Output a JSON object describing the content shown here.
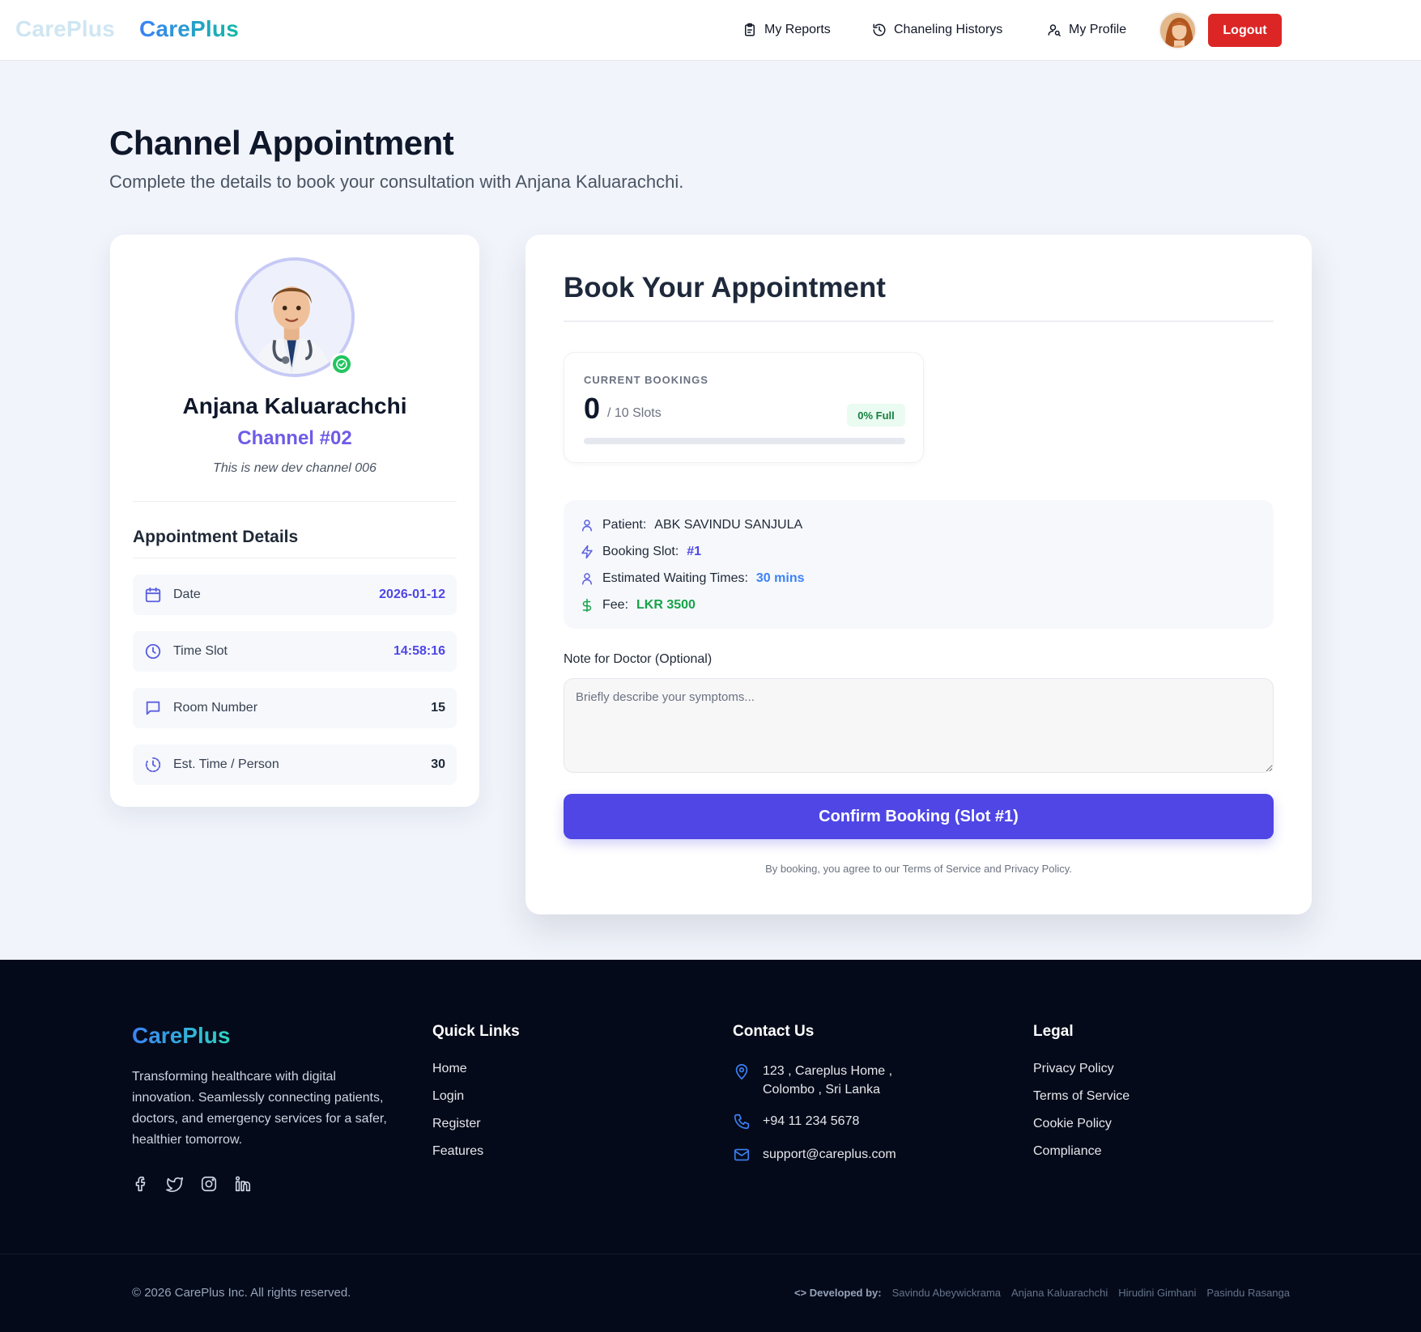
{
  "header": {
    "brand_ghost": "CarePlus",
    "brand": "CarePlus",
    "nav": {
      "reports": "My Reports",
      "history": "Chaneling Historys",
      "profile": "My Profile"
    },
    "logout_label": "Logout"
  },
  "page": {
    "title": "Channel Appointment",
    "subtitle": "Complete the details to book your consultation with Anjana Kaluarachchi."
  },
  "doctor": {
    "name": "Anjana Kaluarachchi",
    "channel": "Channel #02",
    "description": "This is new dev channel 006",
    "details_title": "Appointment Details",
    "details": [
      {
        "label": "Date",
        "value": "2026-01-12",
        "icon": "calendar-icon"
      },
      {
        "label": "Time Slot",
        "value": "14:58:16",
        "icon": "clock-icon"
      },
      {
        "label": "Room Number",
        "value": "15",
        "icon": "message-square-icon"
      },
      {
        "label": "Est. Time / Person",
        "value": "30",
        "icon": "timer-icon"
      }
    ]
  },
  "booking": {
    "title": "Book Your Appointment",
    "current_label": "CURRENT BOOKINGS",
    "current_count": "0",
    "slots_text": "/ 10 Slots",
    "full_pill": "0% Full",
    "fill_fraction": 0,
    "summary": {
      "patient_label": "Patient:",
      "patient_value": "ABK SAVINDU SANJULA",
      "slot_label": "Booking Slot:",
      "slot_value": "#1",
      "wait_label": "Estimated Waiting Times:",
      "wait_value": "30 mins",
      "fee_label": "Fee:",
      "fee_value": "LKR 3500"
    },
    "note_label": "Note for Doctor (Optional)",
    "note_placeholder": "Briefly describe your symptoms...",
    "note_value": "",
    "confirm_label": "Confirm Booking (Slot #1)",
    "terms": "By booking, you agree to our Terms of Service and Privacy Policy."
  },
  "footer": {
    "brand": "CarePlus",
    "about": "Transforming healthcare with digital innovation. Seamlessly connecting patients, doctors, and emergency services for a safer, healthier tomorrow.",
    "quick_links_title": "Quick Links",
    "quick_links": [
      "Home",
      "Login",
      "Register",
      "Features"
    ],
    "contact_title": "Contact Us",
    "contact": {
      "address_line1": "123 , Careplus Home ,",
      "address_line2": "Colombo , Sri Lanka",
      "phone": "+94 11 234 5678",
      "email": "support@careplus.com"
    },
    "legal_title": "Legal",
    "legal_links": [
      "Privacy Policy",
      "Terms of Service",
      "Cookie Policy",
      "Compliance"
    ],
    "copyright": "© 2026 CarePlus Inc. All rights reserved.",
    "dev_label": "Developed by:",
    "developers": [
      "Savindu Abeywickrama",
      "Anjana Kaluarachchi",
      "Hirudini Gimhani",
      "Pasindu Rasanga"
    ]
  },
  "colors": {
    "primary": "#4f46e5",
    "logout": "#dc2626",
    "success": "#16a34a",
    "footer_bg": "#050a1a"
  }
}
